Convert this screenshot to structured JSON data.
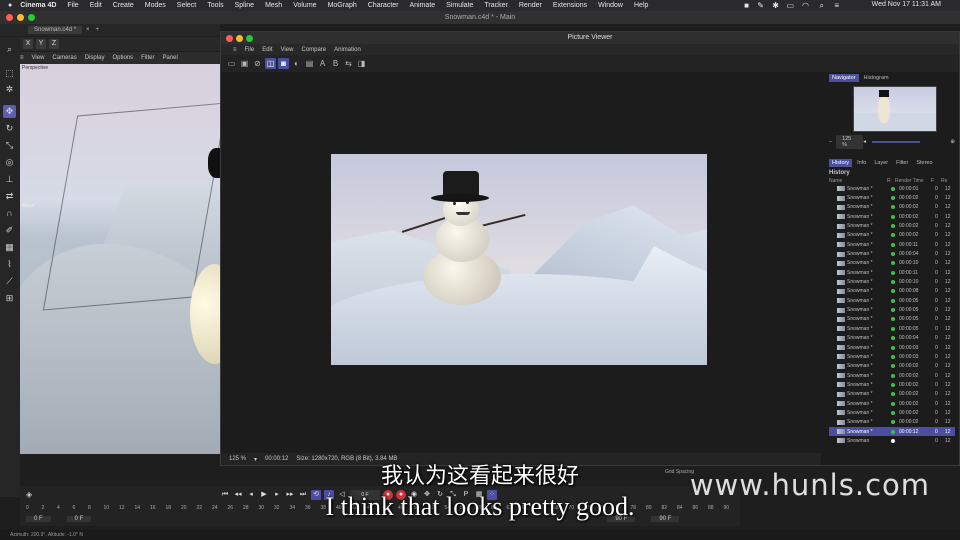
{
  "macbar": {
    "app": "Cinema 4D",
    "menus": [
      "File",
      "Edit",
      "Create",
      "Modes",
      "Select",
      "Tools",
      "Spline",
      "Mesh",
      "Volume",
      "MoGraph",
      "Character",
      "Animate",
      "Simulate",
      "Tracker",
      "Render",
      "Extensions",
      "Window",
      "Help"
    ],
    "clock": "Wed Nov 17  11:31 AM"
  },
  "c4d": {
    "window_title": "Snowman.c4d * - Main",
    "doc_tab": "Snowman.c4d *",
    "axis_buttons": [
      "X",
      "Y",
      "Z"
    ],
    "viewport_menu": [
      "View",
      "Cameras",
      "Display",
      "Options",
      "Filter",
      "Panel"
    ],
    "viewport_label": "Perspective",
    "move_label": "Move"
  },
  "picture_viewer": {
    "title": "Picture Viewer",
    "menu": [
      "File",
      "Edit",
      "View",
      "Compare",
      "Animation"
    ],
    "zoom": "125 %",
    "time": "00:00:12",
    "size_info": "Size: 1280x720, RGB (8 Bit), 3.84 MB",
    "grid_label": "Grid Spacing",
    "panel_tabs": [
      "Navigator",
      "Histogram"
    ],
    "panel_zoom": "125 %",
    "history_tabs": [
      "History",
      "Info",
      "Layer",
      "Filter",
      "Stereo"
    ],
    "history_heading": "History",
    "history_cols": [
      "Name",
      "R",
      "Render Time",
      "F",
      "Re"
    ],
    "history_rows": [
      {
        "name": "Snowman *",
        "time": "00:00:01",
        "f": "0",
        "r": "12"
      },
      {
        "name": "Snowman *",
        "time": "00:00:02",
        "f": "0",
        "r": "12"
      },
      {
        "name": "Snowman *",
        "time": "00:00:02",
        "f": "0",
        "r": "12"
      },
      {
        "name": "Snowman *",
        "time": "00:00:02",
        "f": "0",
        "r": "12"
      },
      {
        "name": "Snowman *",
        "time": "00:00:02",
        "f": "0",
        "r": "12"
      },
      {
        "name": "Snowman *",
        "time": "00:00:02",
        "f": "0",
        "r": "12"
      },
      {
        "name": "Snowman *",
        "time": "00:00:11",
        "f": "0",
        "r": "12"
      },
      {
        "name": "Snowman *",
        "time": "00:00:04",
        "f": "0",
        "r": "12"
      },
      {
        "name": "Snowman *",
        "time": "00:00:10",
        "f": "0",
        "r": "12"
      },
      {
        "name": "Snowman *",
        "time": "00:00:11",
        "f": "0",
        "r": "12"
      },
      {
        "name": "Snowman *",
        "time": "00:00:10",
        "f": "0",
        "r": "12"
      },
      {
        "name": "Snowman *",
        "time": "00:00:08",
        "f": "0",
        "r": "12"
      },
      {
        "name": "Snowman *",
        "time": "00:00:05",
        "f": "0",
        "r": "12"
      },
      {
        "name": "Snowman *",
        "time": "00:00:05",
        "f": "0",
        "r": "12"
      },
      {
        "name": "Snowman *",
        "time": "00:00:05",
        "f": "0",
        "r": "12"
      },
      {
        "name": "Snowman *",
        "time": "00:00:05",
        "f": "0",
        "r": "12"
      },
      {
        "name": "Snowman *",
        "time": "00:00:04",
        "f": "0",
        "r": "12"
      },
      {
        "name": "Snowman *",
        "time": "00:00:03",
        "f": "0",
        "r": "12"
      },
      {
        "name": "Snowman *",
        "time": "00:00:03",
        "f": "0",
        "r": "12"
      },
      {
        "name": "Snowman *",
        "time": "00:00:02",
        "f": "0",
        "r": "12"
      },
      {
        "name": "Snowman *",
        "time": "00:00:02",
        "f": "0",
        "r": "12"
      },
      {
        "name": "Snowman *",
        "time": "00:00:02",
        "f": "0",
        "r": "12"
      },
      {
        "name": "Snowman *",
        "time": "00:00:02",
        "f": "0",
        "r": "12"
      },
      {
        "name": "Snowman *",
        "time": "00:00:02",
        "f": "0",
        "r": "12"
      },
      {
        "name": "Snowman *",
        "time": "00:00:02",
        "f": "0",
        "r": "12"
      },
      {
        "name": "Snowman *",
        "time": "00:00:02",
        "f": "0",
        "r": "12"
      },
      {
        "name": "Snowman *",
        "time": "00:00:12",
        "f": "0",
        "r": "12",
        "selected": true
      },
      {
        "name": "Snowman",
        "time": "",
        "f": "0",
        "r": "12",
        "current": true
      }
    ]
  },
  "timeline": {
    "ruler": [
      "0",
      "2",
      "4",
      "6",
      "8",
      "10",
      "12",
      "14",
      "16",
      "18",
      "20",
      "22",
      "24",
      "26",
      "28",
      "30",
      "32",
      "34",
      "36",
      "38",
      "40",
      "42",
      "44",
      "46",
      "48",
      "50",
      "52",
      "54",
      "56",
      "58",
      "60",
      "62",
      "64",
      "66",
      "68",
      "70",
      "72",
      "74",
      "76",
      "78",
      "80",
      "82",
      "84",
      "86",
      "88",
      "90"
    ],
    "start_field": "0 F",
    "start_field2": "0 F",
    "end_field": "90 F",
    "end_field2": "90 F",
    "current_frame": "0 F"
  },
  "statusbar": "Azimuth: 200.9°, Altitude: -1.0°  N",
  "subtitles": {
    "cn": "我认为这看起来很好",
    "en": "I think that looks pretty good."
  },
  "watermark": "www.hunls.com",
  "colors": {
    "accent": "#4a4fa0",
    "green": "#3cc24a",
    "record": "#c7343a"
  }
}
